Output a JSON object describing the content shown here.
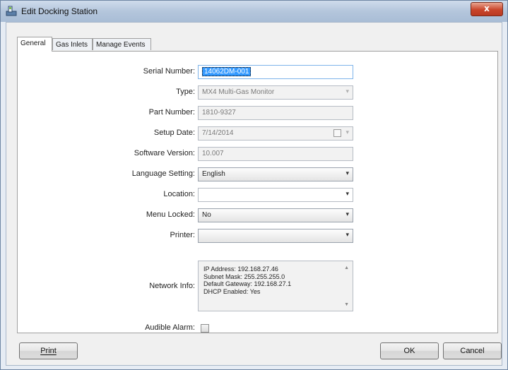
{
  "window": {
    "title": "Edit Docking Station",
    "close_label": "x"
  },
  "tabs": [
    {
      "label": "General",
      "active": true
    },
    {
      "label": "Gas Inlets",
      "active": false
    },
    {
      "label": "Manage Events",
      "active": false
    }
  ],
  "form": {
    "serial_number": {
      "label": "Serial Number:",
      "value": "14062DM-001"
    },
    "type": {
      "label": "Type:",
      "value": "MX4 Multi-Gas Monitor"
    },
    "part_number": {
      "label": "Part Number:",
      "value": "1810-9327"
    },
    "setup_date": {
      "label": "Setup Date:",
      "value": "7/14/2014"
    },
    "software_version": {
      "label": "Software Version:",
      "value": "10.007"
    },
    "language_setting": {
      "label": "Language Setting:",
      "value": "English"
    },
    "location": {
      "label": "Location:",
      "value": ""
    },
    "menu_locked": {
      "label": "Menu Locked:",
      "value": "No"
    },
    "printer": {
      "label": "Printer:",
      "value": ""
    },
    "network_info": {
      "label": "Network Info:",
      "lines": [
        "IP Address: 192.168.27.46",
        "Subnet Mask: 255.255.255.0",
        "Default Gateway: 192.168.27.1",
        "DHCP Enabled: Yes"
      ]
    },
    "audible_alarm": {
      "label": "Audible Alarm:",
      "checked": false
    }
  },
  "buttons": {
    "print": "Print",
    "ok": "OK",
    "cancel": "Cancel"
  }
}
